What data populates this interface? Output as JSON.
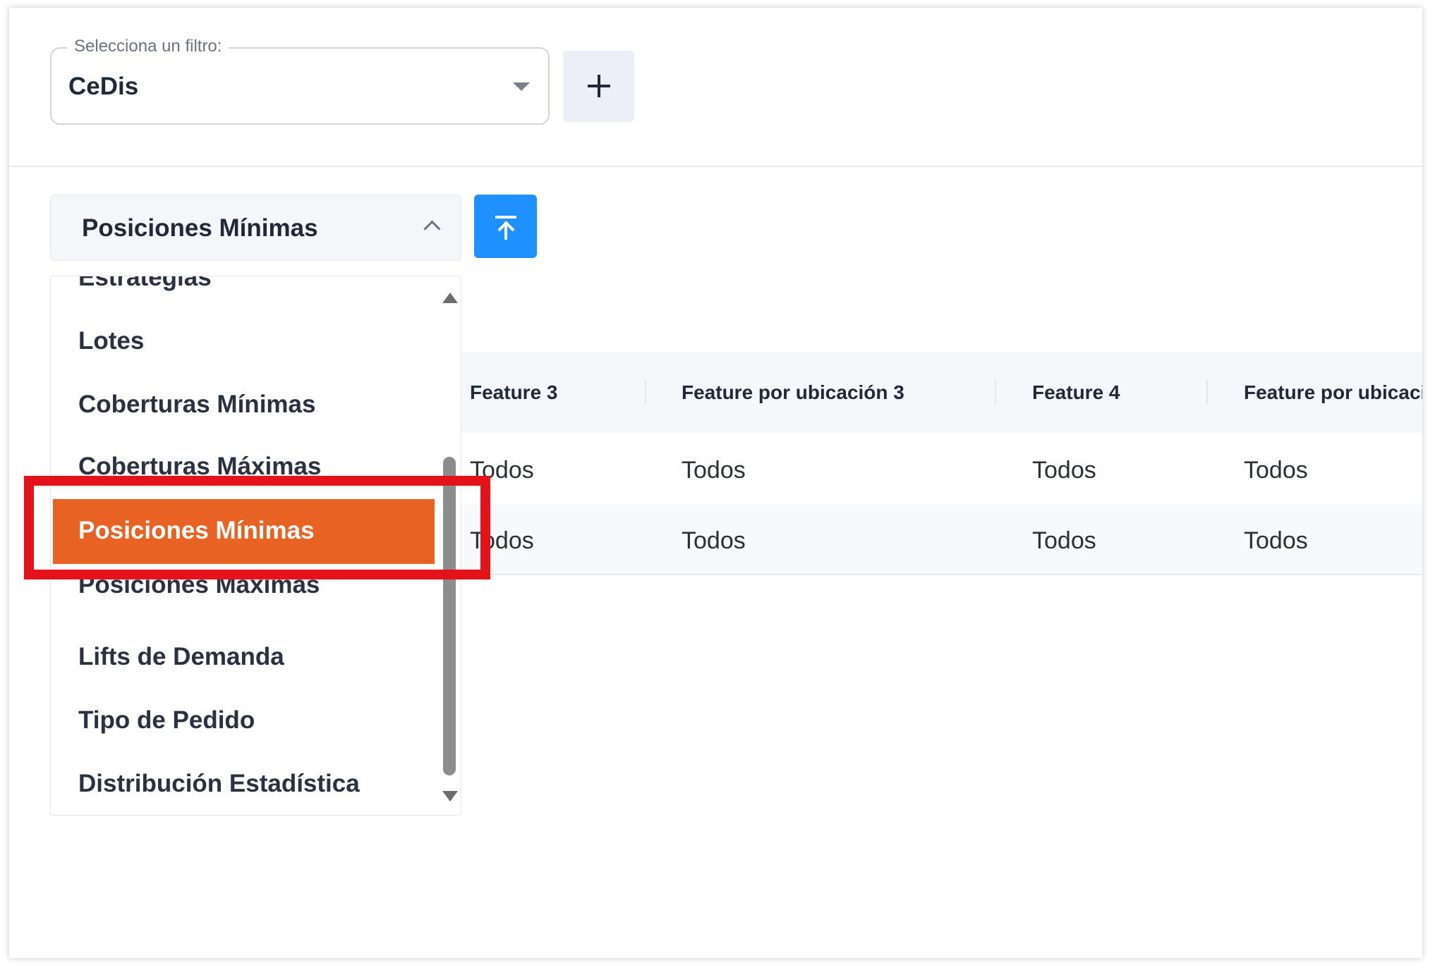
{
  "filter": {
    "legend": "Selecciona un filtro:",
    "value": "CeDis",
    "add_label": "+"
  },
  "table_selector": {
    "value": "Posiciones Mínimas"
  },
  "colors": {
    "accent_blue": "#1e90ff",
    "selected_orange": "#e86323",
    "highlight_red": "#e5121b"
  },
  "dropdown": {
    "options": [
      "Estrategias",
      "Lotes",
      "Coberturas Mínimas",
      "Coberturas Máximas",
      "Posiciones Mínimas",
      "Posiciones Máximas",
      "Lifts de Demanda",
      "Tipo de Pedido",
      "Distribución Estadística"
    ],
    "selected": "Posiciones Mínimas"
  },
  "table": {
    "headers": [
      "Feature 3",
      "Feature por ubicación 3",
      "Feature 4",
      "Feature por ubicaci"
    ],
    "rows": [
      [
        "Todos",
        "Todos",
        "Todos",
        "Todos"
      ],
      [
        "Todos",
        "Todos",
        "Todos",
        "Todos"
      ]
    ]
  }
}
